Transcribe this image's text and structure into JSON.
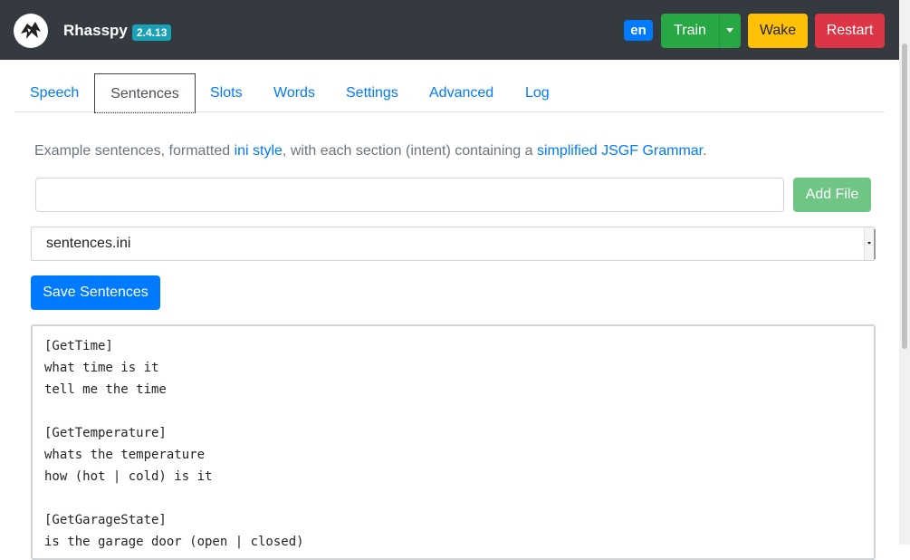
{
  "navbar": {
    "brand": "Rhasspy",
    "version": "2.4.13",
    "language": "en",
    "train_label": "Train",
    "wake_label": "Wake",
    "restart_label": "Restart"
  },
  "tabs": [
    {
      "label": "Speech"
    },
    {
      "label": "Sentences"
    },
    {
      "label": "Slots"
    },
    {
      "label": "Words"
    },
    {
      "label": "Settings"
    },
    {
      "label": "Advanced"
    },
    {
      "label": "Log"
    }
  ],
  "active_tab": "Sentences",
  "intro": {
    "part1": "Example sentences, formatted ",
    "link1": "ini style",
    "part2": ", with each section (intent) containing a ",
    "link2": "simplified JSGF Grammar",
    "part3": "."
  },
  "file_input": {
    "value": "",
    "placeholder": ""
  },
  "add_file_label": "Add File",
  "file_select": {
    "selected": "sentences.ini"
  },
  "save_label": "Save Sentences",
  "editor_text": "[GetTime]\nwhat time is it\ntell me the time\n\n[GetTemperature]\nwhats the temperature\nhow (hot | cold) is it\n\n[GetGarageState]\nis the garage door (open | closed)",
  "colors": {
    "navbar": "#343a40",
    "primary": "#007bff",
    "success": "#28a745",
    "warning": "#ffc107",
    "danger": "#dc3545",
    "info": "#17a2b8"
  }
}
